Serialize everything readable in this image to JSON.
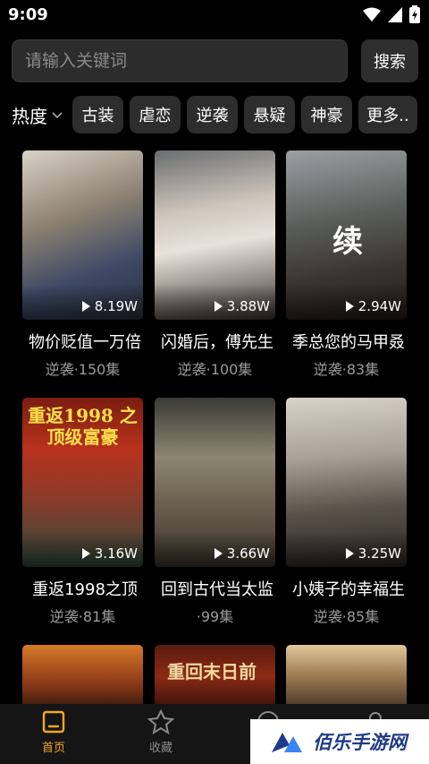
{
  "status": {
    "time": "9:09"
  },
  "search": {
    "placeholder": "请输入关键词",
    "button_label": "搜索"
  },
  "filters": {
    "hot_label": "热度",
    "tags": [
      "古装",
      "虐恋",
      "逆袭",
      "悬疑",
      "神豪",
      "更多.."
    ]
  },
  "dramas": [
    {
      "title": "物价贬值一万倍",
      "meta": "逆袭·150集",
      "plays": "8.19W",
      "poster_text": ""
    },
    {
      "title": "闪婚后，傅先生",
      "meta": "逆袭·100集",
      "plays": "3.88W",
      "poster_text": ""
    },
    {
      "title": "季总您的马甲叒",
      "meta": "逆袭·83集",
      "plays": "2.94W",
      "poster_text": "续"
    },
    {
      "title": "重返1998之顶",
      "meta": "逆袭·81集",
      "plays": "3.16W",
      "poster_text": "重返1998 之顶级富豪"
    },
    {
      "title": "回到古代当太监",
      "meta": "·99集",
      "plays": "3.66W",
      "poster_text": ""
    },
    {
      "title": "小姨子的幸福生",
      "meta": "逆袭·85集",
      "plays": "3.25W",
      "poster_text": ""
    },
    {
      "title": "",
      "meta": "",
      "plays": "",
      "poster_text": ""
    },
    {
      "title": "",
      "meta": "",
      "plays": "",
      "poster_text": "重回末日前"
    },
    {
      "title": "",
      "meta": "",
      "plays": "",
      "poster_text": ""
    }
  ],
  "tabs": [
    {
      "label": "首页",
      "icon": "home-icon",
      "active": true
    },
    {
      "label": "收藏",
      "icon": "star-icon",
      "active": false
    }
  ],
  "watermark": {
    "text": "佰乐手游网"
  },
  "colors": {
    "accent": "#f5a623",
    "background": "#000000",
    "chip": "#2d2d2d"
  }
}
